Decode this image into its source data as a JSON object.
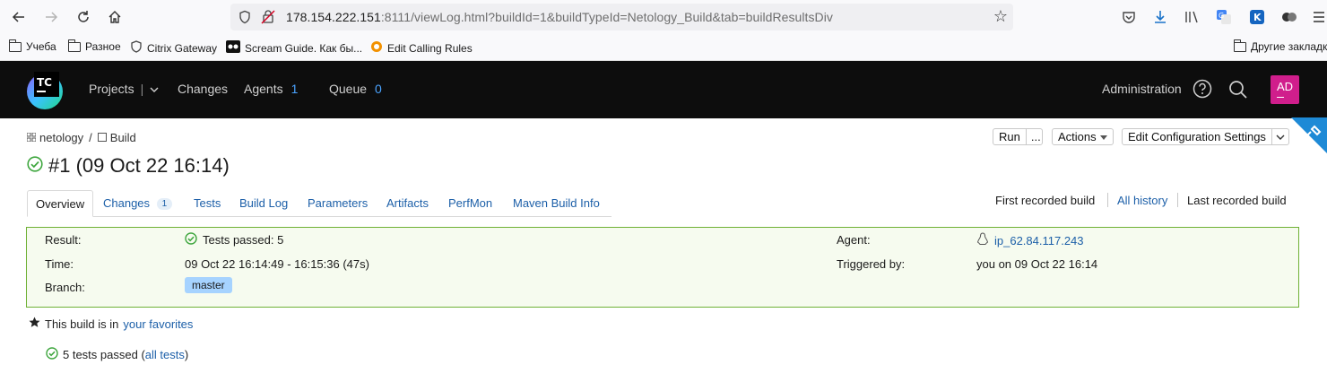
{
  "browser": {
    "url_host": "178.154.222.151",
    "url_rest": ":8111/viewLog.html?buildId=1&buildTypeId=Netology_Build&tab=buildResultsDiv",
    "bookmarks": [
      {
        "label": "Учеба",
        "icon": "folder-icon"
      },
      {
        "label": "Разное",
        "icon": "folder-icon"
      },
      {
        "label": "Citrix Gateway",
        "icon": "citrix-icon"
      },
      {
        "label": "Scream Guide. Как бы...",
        "icon": "scream-icon"
      },
      {
        "label": "Edit Calling Rules",
        "icon": "rules-icon"
      }
    ],
    "other_bookmarks": "Другие закладки"
  },
  "tc": {
    "logo_text": "TC",
    "nav": {
      "projects": "Projects",
      "changes": "Changes",
      "agents": "Agents",
      "agents_count": "1",
      "queue": "Queue",
      "queue_count": "0"
    },
    "administration": "Administration",
    "avatar": "AD"
  },
  "page": {
    "breadcrumb": {
      "project": "netology",
      "separator": "/",
      "build": "Build"
    },
    "title": "#1 (09 Oct 22 16:14)",
    "buttons": {
      "run": "Run",
      "more": "...",
      "actions": "Actions",
      "edit": "Edit Configuration Settings"
    },
    "tabs": [
      {
        "label": "Overview",
        "badge": ""
      },
      {
        "label": "Changes",
        "badge": "1"
      },
      {
        "label": "Tests",
        "badge": ""
      },
      {
        "label": "Build Log",
        "badge": ""
      },
      {
        "label": "Parameters",
        "badge": ""
      },
      {
        "label": "Artifacts",
        "badge": ""
      },
      {
        "label": "PerfMon",
        "badge": ""
      },
      {
        "label": "Maven Build Info",
        "badge": ""
      }
    ],
    "history": {
      "first": "First recorded build",
      "all": "All history",
      "last": "Last recorded build"
    },
    "result": {
      "result_label": "Result:",
      "result_value": "Tests passed: 5",
      "time_label": "Time:",
      "time_value": "09 Oct 22 16:14:49 - 16:15:36 (47s)",
      "branch_label": "Branch:",
      "branch_value": "master",
      "agent_label": "Agent:",
      "agent_value": "ip_62.84.117.243",
      "triggered_label": "Triggered by:",
      "triggered_value": "you on 09 Oct 22 16:14"
    },
    "favorites": {
      "prefix": "This build is in",
      "link": "your favorites"
    },
    "tests": {
      "text": "5 tests passed (",
      "link": "all tests",
      "suffix": ")"
    }
  },
  "colors": {
    "success": "#3ea63e",
    "link": "#1c5fa8",
    "avatar": "#d01e8c",
    "result_border": "#6fb135"
  }
}
